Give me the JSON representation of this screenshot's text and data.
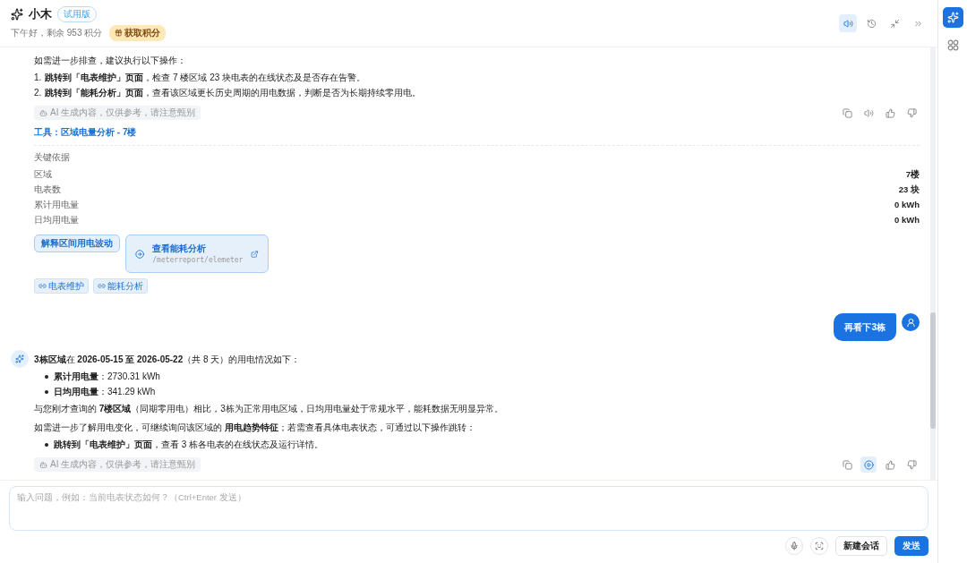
{
  "header": {
    "title": "小木",
    "badge": "试用版",
    "greeting": "下午好，剩余 953 积分",
    "points_button": "获取积分",
    "actions": [
      {
        "kind": "speaker",
        "selected": true
      },
      {
        "kind": "history",
        "selected": false
      },
      {
        "kind": "collapse",
        "selected": false
      },
      {
        "kind": "hide",
        "selected": false
      }
    ]
  },
  "side_rail": [
    {
      "kind": "assistant",
      "selected": true
    },
    {
      "kind": "apps",
      "selected": false
    }
  ],
  "earlier_reply": {
    "paragraphs": [
      "如需进一步排查，建议执行以下操作："
    ],
    "steps": [
      {
        "number": "1.",
        "text": "**跳转到「电表维护」页面**，检查 7 楼区域 23 块电表的在线状态及是否存在告警。"
      },
      {
        "number": "2.",
        "text": "**跳转到「能耗分析」页面**，查看该区域更长历史周期的用电数据，判断是否为长期持续零用电。"
      }
    ],
    "disclaimer": "AI 生成内容，仅供参考，请注意甄别",
    "actions": [
      {
        "kind": "copy",
        "selected": false
      },
      {
        "kind": "speaker",
        "selected": false
      },
      {
        "kind": "like",
        "selected": false
      },
      {
        "kind": "dislike",
        "selected": false
      }
    ],
    "tool_link": "工具：区域电量分析 - 7楼",
    "key_basis": {
      "title": "关键依据",
      "rows": [
        {
          "label": "区域",
          "value": "7楼"
        },
        {
          "label": "电表数",
          "value": "23 块"
        },
        {
          "label": "累计用电量",
          "value": "0 kWh"
        },
        {
          "label": "日均用电量",
          "value": "0 kWh"
        }
      ]
    },
    "suggestion": "解释区间用电波动",
    "nav_card": {
      "title": "查看能耗分析",
      "path": "/meterreport/elemeter"
    },
    "links": [
      "电表维护",
      "能耗分析"
    ]
  },
  "user_message": "再看下3栋",
  "reply": {
    "intro": "**3栋区域**在 **2026-05-15 至 2026-05-22**（共 8 天）的用电情况如下：",
    "bullets": [
      "**累计用电量**：2730.31 kWh",
      "**日均用电量**：341.29 kWh"
    ],
    "paragraphs": [
      "与您刚才查询的 **7楼区域**（同期零用电）相比，3栋为正常用电区域，日均用电量处于常规水平，能耗数据无明显异常。",
      "如需进一步了解用电变化，可继续询问该区域的 **用电趋势特征**；若需查看具体电表状态，可通过以下操作跳转："
    ],
    "steps": [
      "**跳转到「电表维护」页面**，查看 3 栋各电表的在线状态及运行详情。"
    ],
    "disclaimer": "AI 生成内容，仅供参考，请注意甄别",
    "actions": [
      {
        "kind": "copy",
        "selected": false
      },
      {
        "kind": "play",
        "selected": true
      },
      {
        "kind": "like",
        "selected": false
      },
      {
        "kind": "dislike",
        "selected": false
      }
    ]
  },
  "composer": {
    "placeholder": "输入问题，例如：当前电表状态如何？（Ctrl+Enter 发送）",
    "new_chat_button": "新建会话",
    "send_button": "发送"
  }
}
